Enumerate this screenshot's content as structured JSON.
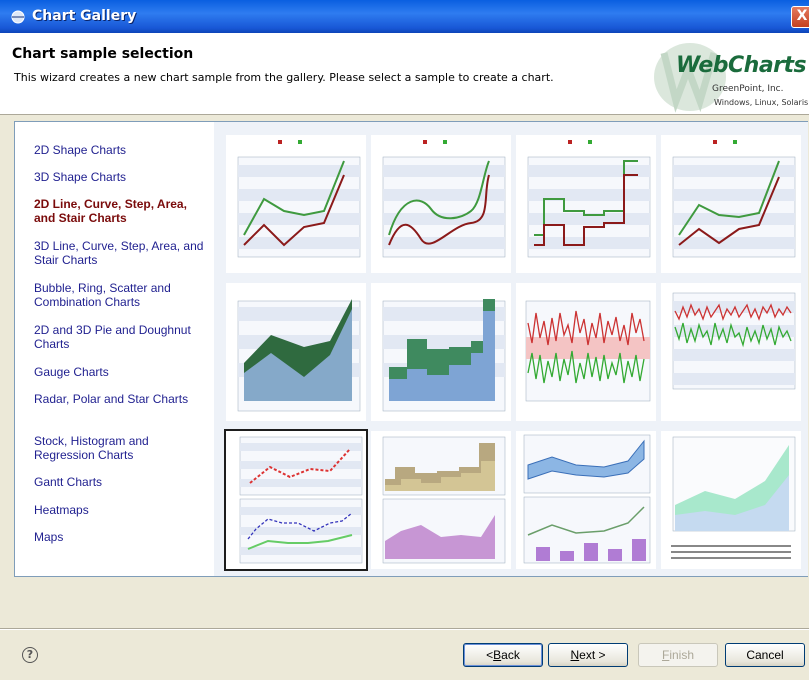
{
  "window": {
    "title": "Chart Gallery",
    "close_label": "X"
  },
  "header": {
    "title": "Chart sample selection",
    "description": "This wizard creates a new chart sample from the gallery. Please select a sample to create a chart."
  },
  "logo": {
    "brand": "WebCharts",
    "company": "GreenPoint, Inc.",
    "platforms": "Windows, Linux, Solaris"
  },
  "categories": [
    {
      "label": "2D Shape Charts",
      "selected": false
    },
    {
      "label": "3D Shape Charts",
      "selected": false
    },
    {
      "label": "2D Line, Curve, Step, Area, and Stair Charts",
      "selected": true
    },
    {
      "label": "3D Line, Curve, Step, Area, and Stair Charts",
      "selected": false
    },
    {
      "label": "Bubble, Ring, Scatter and Combination Charts",
      "selected": false
    },
    {
      "label": "2D and 3D Pie and Doughnut Charts",
      "selected": false
    },
    {
      "label": "Gauge Charts",
      "selected": false
    },
    {
      "label": "Radar, Polar and Star Charts",
      "selected": false
    },
    {
      "label": "Stock, Histogram and Regression Charts",
      "selected": false
    },
    {
      "label": "Gantt Charts",
      "selected": false
    },
    {
      "label": "Heatmaps",
      "selected": false
    },
    {
      "label": "Maps",
      "selected": false
    }
  ],
  "thumbnails": [
    {
      "id": "line",
      "selected": false
    },
    {
      "id": "curve",
      "selected": false
    },
    {
      "id": "step",
      "selected": false
    },
    {
      "id": "line-2",
      "selected": false
    },
    {
      "id": "area",
      "selected": false
    },
    {
      "id": "step-area",
      "selected": false
    },
    {
      "id": "dense-line",
      "selected": false
    },
    {
      "id": "dense-line-2",
      "selected": false
    },
    {
      "id": "dashed-line-stack",
      "selected": true
    },
    {
      "id": "stair-area-stack",
      "selected": false
    },
    {
      "id": "area-bar-combo",
      "selected": false
    },
    {
      "id": "stacked-area",
      "selected": false
    }
  ],
  "footer": {
    "help_icon": "?",
    "back": {
      "pre": "<",
      "u": "B",
      "post": "ack"
    },
    "next": {
      "u": "N",
      "post": "ext >"
    },
    "finish": {
      "u": "F",
      "post": "inish"
    },
    "cancel": "Cancel"
  },
  "colors": {
    "series_red": "#8b1a1a",
    "series_green": "#3f9a3f",
    "link": "#1f1f8f",
    "selected_link": "#7a0b0b"
  }
}
